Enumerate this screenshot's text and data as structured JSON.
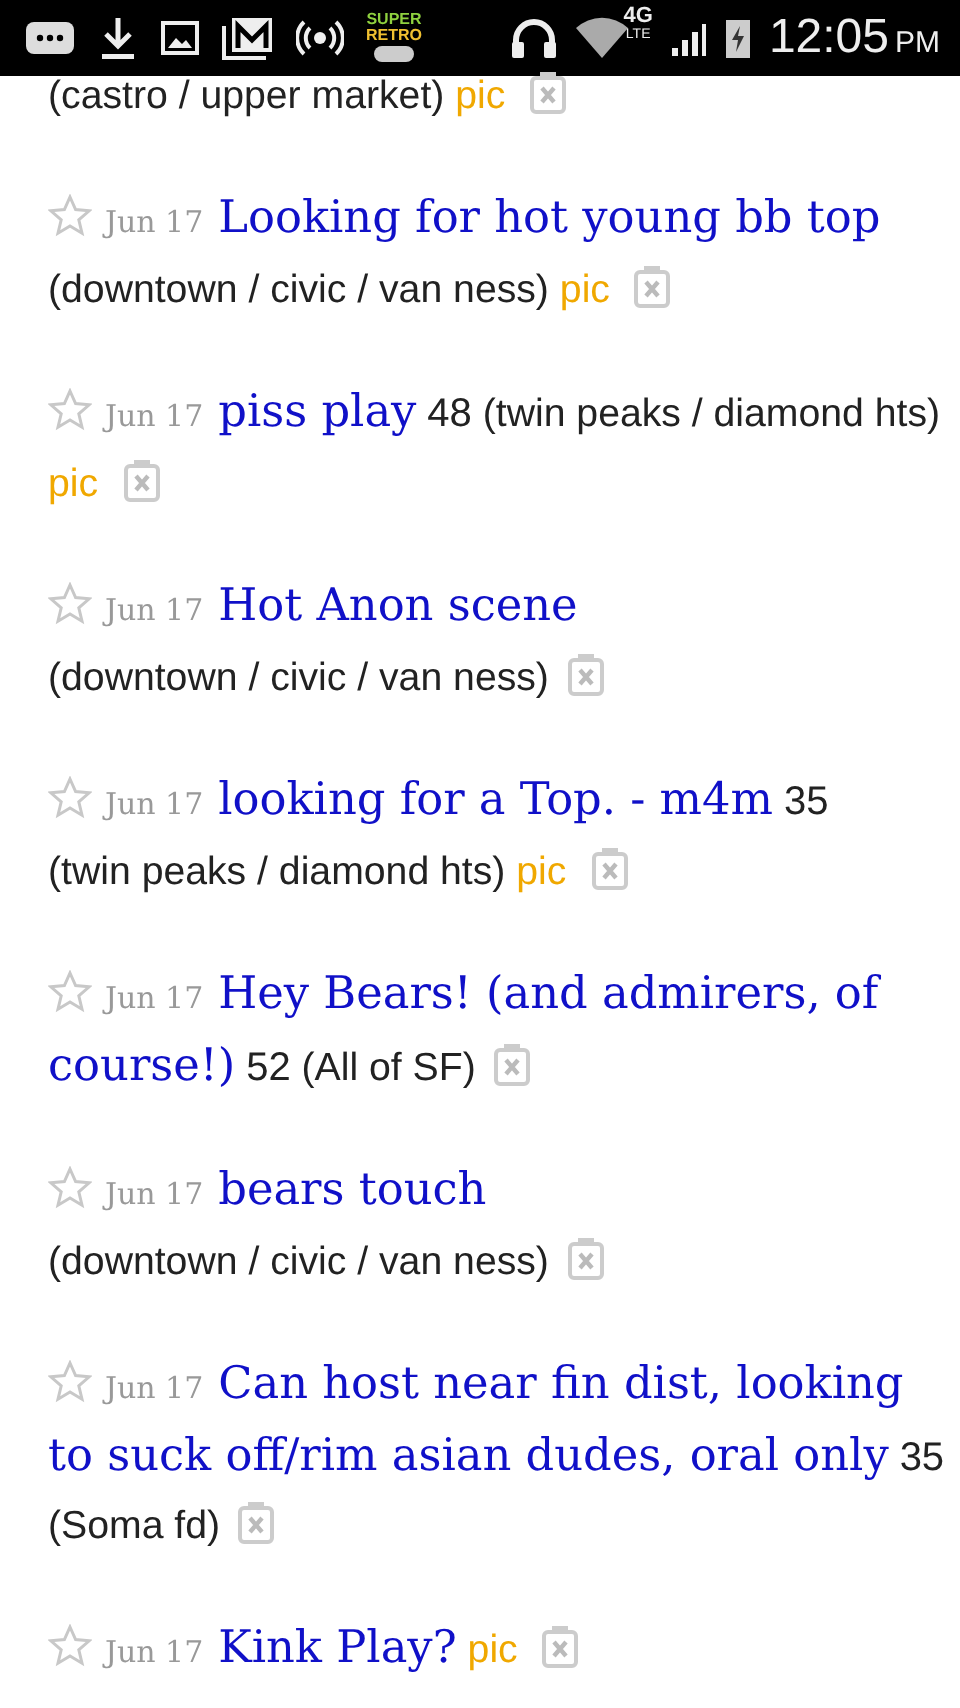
{
  "status_bar": {
    "time": "12:05",
    "meridiem": "PM",
    "network": "4G",
    "network_sub": "LTE",
    "app_badge": [
      "SUPER",
      "RETRO"
    ]
  },
  "posts": [
    {
      "location": "(castro / upper market)",
      "pic": "pic"
    },
    {
      "favorited": false,
      "date": "Jun 17",
      "title": "Looking for hot young bb top",
      "location": "(downtown / civic / van ness)",
      "pic": "pic"
    },
    {
      "favorited": false,
      "date": "Jun 17",
      "title": "piss play",
      "price": "48",
      "location": "(twin peaks / diamond hts)",
      "pic": "pic"
    },
    {
      "favorited": false,
      "date": "Jun 17",
      "title": "Hot Anon scene",
      "location": "(downtown / civic / van ness)"
    },
    {
      "favorited": false,
      "date": "Jun 17",
      "title": "looking for a Top. - m4m",
      "price": "35",
      "location": "(twin peaks / diamond hts)",
      "pic": "pic"
    },
    {
      "favorited": false,
      "date": "Jun 17",
      "title": [
        "Hey Bears! (and admirers, of",
        "course!)"
      ],
      "price": "52",
      "location": "(All of SF)"
    },
    {
      "favorited": false,
      "date": "Jun 17",
      "title": "bears touch",
      "location": "(downtown / civic / van ness)"
    },
    {
      "favorited": false,
      "date": "Jun 17",
      "title": [
        "Can host near fin dist, looking",
        "to suck off/rim asian dudes, oral only"
      ],
      "price": "35",
      "location": "(Soma fd)"
    },
    {
      "favorited": false,
      "date": "Jun 17",
      "title": "Kink Play?",
      "pic": "pic"
    }
  ]
}
